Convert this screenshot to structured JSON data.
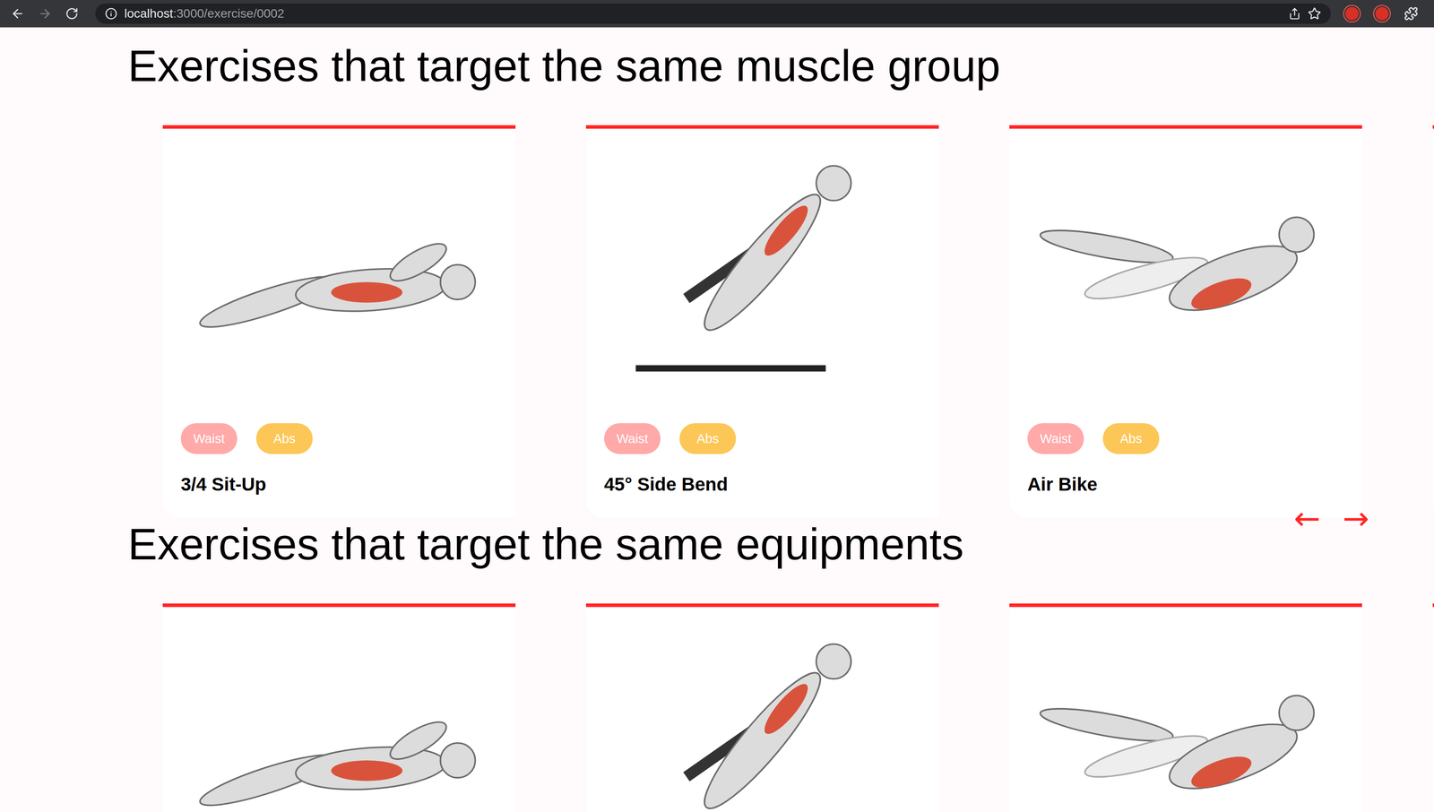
{
  "browser": {
    "url_host": "localhost",
    "url_path": ":3000/exercise/0002",
    "back_disabled": false,
    "forward_disabled": true
  },
  "sections": [
    {
      "title": "Exercises that target the same muscle group",
      "arrows": [
        "←",
        "→"
      ],
      "cards": [
        {
          "name": "3/4 Sit-Up",
          "tags": [
            {
              "label": "Waist",
              "color": "#ffa9a9"
            },
            {
              "label": "Abs",
              "color": "#fcc757"
            }
          ]
        },
        {
          "name": "45° Side Bend",
          "tags": [
            {
              "label": "Waist",
              "color": "#ffa9a9"
            },
            {
              "label": "Abs",
              "color": "#fcc757"
            }
          ]
        },
        {
          "name": "Air Bike",
          "tags": [
            {
              "label": "Waist",
              "color": "#ffa9a9"
            },
            {
              "label": "Abs",
              "color": "#fcc757"
            }
          ]
        },
        {
          "tags": []
        }
      ]
    },
    {
      "title": "Exercises that target the same equipments",
      "arrows": [],
      "cards": [
        {
          "tags": []
        },
        {
          "tags": []
        },
        {
          "tags": []
        },
        {
          "tags": []
        }
      ]
    }
  ]
}
